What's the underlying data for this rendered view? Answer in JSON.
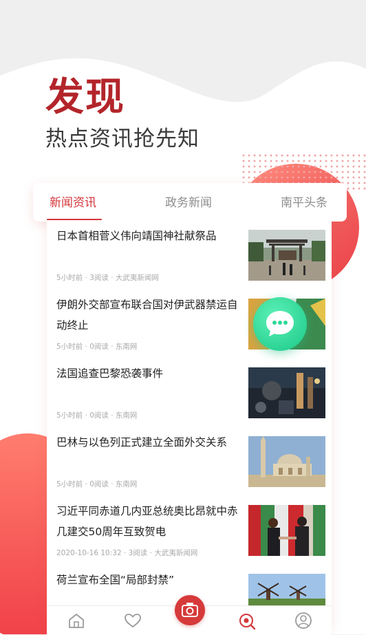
{
  "hero": {
    "title": "发现",
    "subtitle": "热点资讯抢先知"
  },
  "tabs": [
    {
      "label": "新闻资讯",
      "active": true
    },
    {
      "label": "政务新闻",
      "active": false
    },
    {
      "label": "南平头条",
      "active": false
    }
  ],
  "news": [
    {
      "title": "日本首相菅义伟向靖国神社献祭品",
      "meta": "5小时前 · 3阅读 · 大武夷新闻网",
      "thumb": "shrine-photo"
    },
    {
      "title": "伊朗外交部宣布联合国对伊武器禁运自动终止",
      "meta": "5小时前 · 0阅读 · 东南网",
      "thumb": "flags-photo"
    },
    {
      "title": "法国追查巴黎恐袭事件",
      "meta": "5小时前 · 0阅读 · 东南网",
      "thumb": "night-street-photo"
    },
    {
      "title": "巴林与以色列正式建立全面外交关系",
      "meta": "5小时前 · 0阅读 · 东南网",
      "thumb": "mosque-photo"
    },
    {
      "title": "习近平同赤道几内亚总统奥比昂就中赤几建交50周年互致贺电",
      "meta": "2020-10-16 10:32 · 3阅读 · 大武夷新闻网",
      "thumb": "handshake-photo"
    },
    {
      "title": "荷兰宣布全国“局部封禁”",
      "meta": "",
      "thumb": "windmill-photo"
    }
  ],
  "icons": {
    "chat": "chat-bubble-icon",
    "nav": [
      "home-icon",
      "heart-icon",
      "camera-icon",
      "discover-icon",
      "profile-icon"
    ]
  },
  "colors": {
    "accent": "#d4363a",
    "chat": "#2fd89a"
  }
}
